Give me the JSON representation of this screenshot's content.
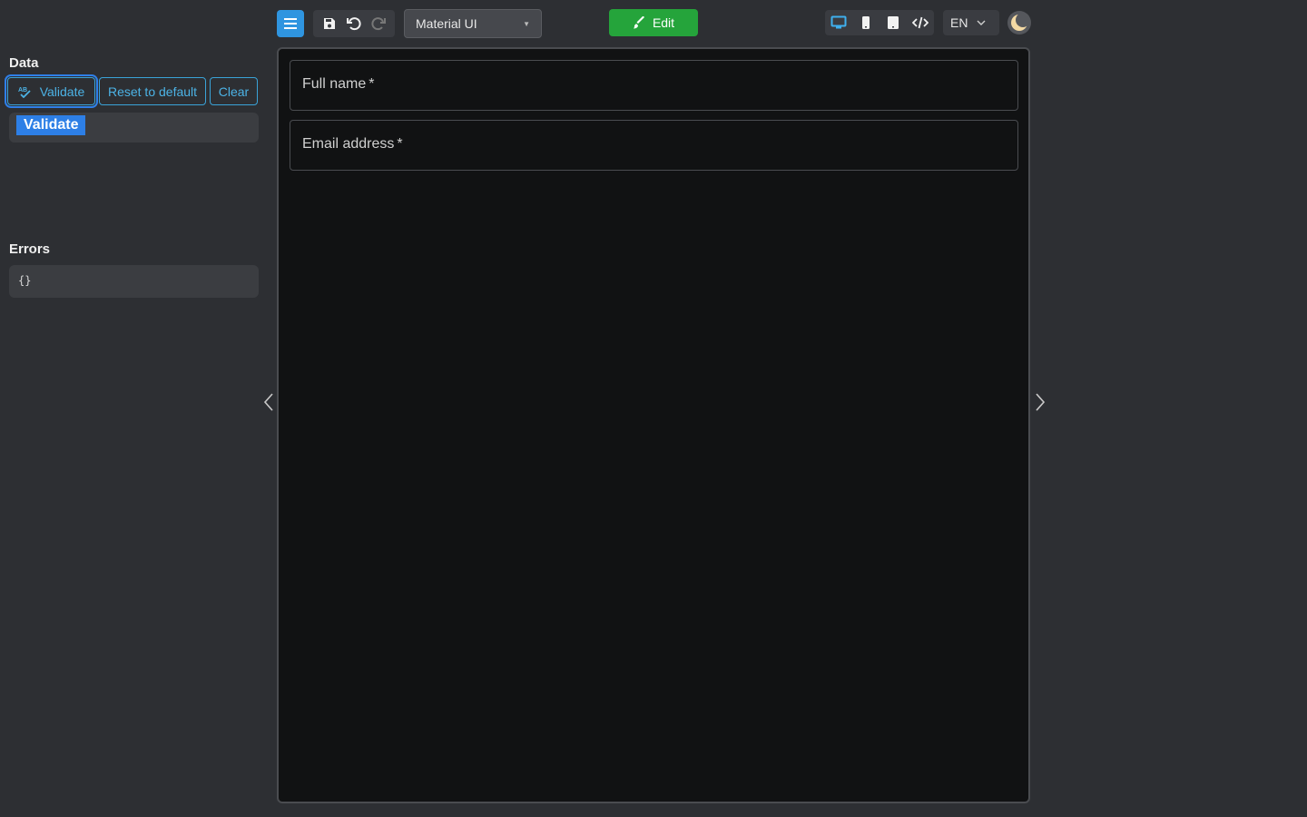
{
  "toolbar": {
    "theme_value": "Material UI",
    "edit_label": "Edit",
    "lang_value": "EN",
    "icons": [
      "menu-icon",
      "save-icon",
      "undo-icon",
      "redo-icon",
      "monitor-icon",
      "phone-icon",
      "tablet-icon",
      "code-icon",
      "moon-icon"
    ],
    "colors": {
      "menu_bg": "#2f95e0",
      "edit_bg": "#25a43b",
      "accent": "#4cb3e6"
    }
  },
  "panel": {
    "data_title": "Data",
    "validate_label": "Validate",
    "reset_label": "Reset to default",
    "clear_label": "Clear",
    "tooltip": "Validate",
    "errors_title": "Errors",
    "errors_value": "{}"
  },
  "form": {
    "fields": [
      {
        "label": "Full name",
        "required_mark": "*"
      },
      {
        "label": "Email address",
        "required_mark": "*"
      }
    ]
  }
}
